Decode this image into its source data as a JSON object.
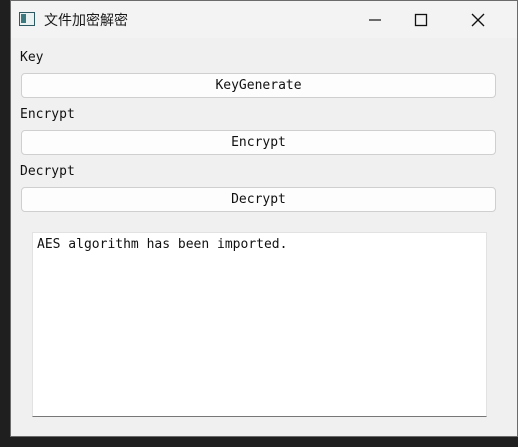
{
  "window": {
    "title": "文件加密解密",
    "controls": {
      "minimize": "minimize-icon",
      "maximize": "maximize-icon",
      "close": "close-icon"
    }
  },
  "sections": {
    "key": {
      "label": "Key",
      "button": "KeyGenerate"
    },
    "encrypt": {
      "label": "Encrypt",
      "button": "Encrypt"
    },
    "decrypt": {
      "label": "Decrypt",
      "button": "Decrypt"
    }
  },
  "output": {
    "text": "AES algorithm has been imported."
  },
  "colors": {
    "window_bg": "#f0f0f0",
    "titlebar_bg": "#f3f3f3",
    "button_bg": "#fdfdfd",
    "button_border": "#cfcfcf",
    "desktop_bg": "#1f1f1f"
  }
}
